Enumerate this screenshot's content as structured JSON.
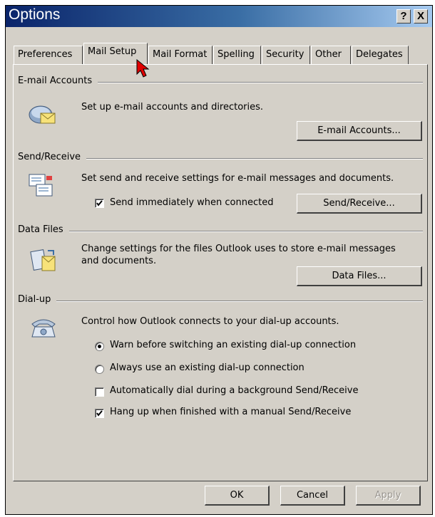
{
  "window": {
    "title": "Options"
  },
  "titlebar": {
    "help_label": "?",
    "close_label": "X"
  },
  "tabs": [
    {
      "label": "Preferences"
    },
    {
      "label": "Mail Setup"
    },
    {
      "label": "Mail Format"
    },
    {
      "label": "Spelling"
    },
    {
      "label": "Security"
    },
    {
      "label": "Other"
    },
    {
      "label": "Delegates"
    }
  ],
  "sections": {
    "email_accounts": {
      "title": "E-mail Accounts",
      "description": "Set up e-mail accounts and directories.",
      "button_label": "E-mail Accounts..."
    },
    "send_receive": {
      "title": "Send/Receive",
      "description": "Set send and receive settings for e-mail messages and documents.",
      "checkbox_label": "Send immediately when connected",
      "checkbox_checked": true,
      "button_label": "Send/Receive..."
    },
    "data_files": {
      "title": "Data Files",
      "description_line1": "Change settings for the files Outlook uses to store e-mail messages",
      "description_line2": "and documents.",
      "button_label": "Data Files..."
    },
    "dialup": {
      "title": "Dial-up",
      "description": "Control how Outlook connects to your dial-up accounts.",
      "radio_warn_label": "Warn before switching an existing dial-up connection",
      "radio_warn_selected": true,
      "radio_always_label": "Always use an existing dial-up connection",
      "radio_always_selected": false,
      "auto_dial_label": "Automatically dial during a background Send/Receive",
      "auto_dial_checked": false,
      "hang_up_label": "Hang up when finished with a manual Send/Receive",
      "hang_up_checked": true
    }
  },
  "footer": {
    "ok_label": "OK",
    "cancel_label": "Cancel",
    "apply_label": "Apply"
  },
  "colors": {
    "dialog_bg": "#d4d0c8",
    "title_start": "#0a246a",
    "title_end": "#a6caf0",
    "cursor": "#e00000"
  }
}
